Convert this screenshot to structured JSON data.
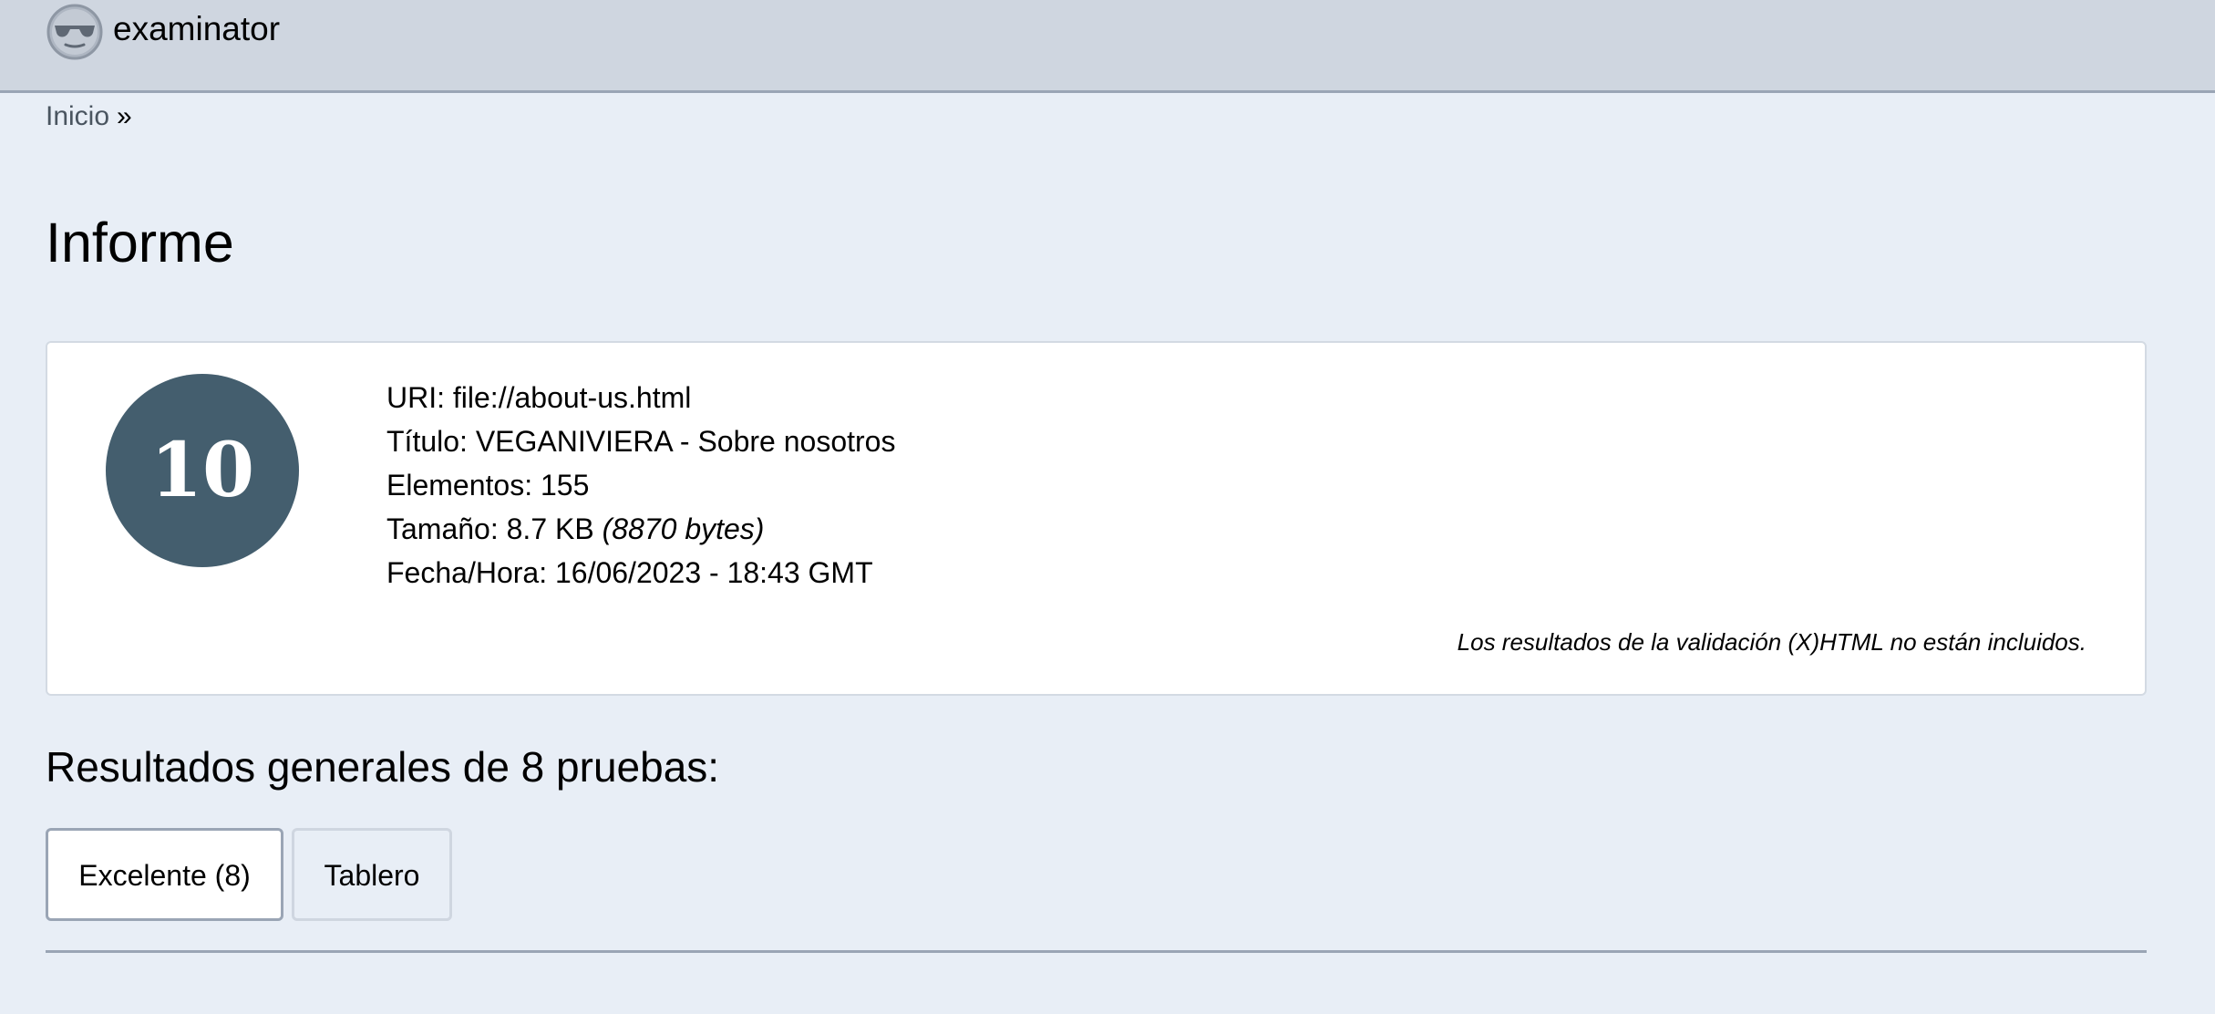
{
  "header": {
    "brand": "examinator",
    "logo_icon": "sunglasses-face-icon"
  },
  "breadcrumb": {
    "home": "Inicio",
    "separator": "»"
  },
  "page": {
    "title": "Informe"
  },
  "report": {
    "score": "10",
    "uri": "URI: file://about-us.html",
    "title": "Título: VEGANIVIERA - Sobre nosotros",
    "elements": "Elementos: 155",
    "size_label": "Tamaño: 8.7 KB",
    "size_bytes": "(8870 bytes)",
    "datetime": "Fecha/Hora: 16/06/2023 - 18:43 GMT",
    "validation_note": "Los resultados de la validación (X)HTML no están incluidos."
  },
  "results": {
    "heading": "Resultados generales de 8 pruebas:",
    "tabs": [
      {
        "label": "Excelente (8)",
        "active": true
      },
      {
        "label": "Tablero",
        "active": false
      }
    ]
  },
  "colors": {
    "topbar": "#cfd6e0",
    "page_bg": "#e8eef6",
    "score_circle": "#445e6e",
    "border": "#9aa5b5"
  }
}
